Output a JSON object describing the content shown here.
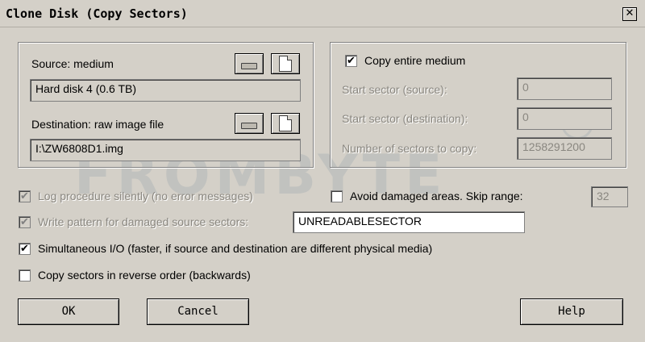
{
  "window": {
    "title": "Clone Disk (Copy Sectors)",
    "close_glyph": "✕"
  },
  "source": {
    "label": "Source: medium",
    "value": "Hard disk 4 (0.6 TB)"
  },
  "destination": {
    "label": "Destination: raw image file",
    "value": "I:\\ZW6808D1.img"
  },
  "copy": {
    "entire_label": "Copy entire medium",
    "entire_checked": true,
    "start_source_label": "Start sector (source):",
    "start_source_value": "0",
    "start_dest_label": "Start sector (destination):",
    "start_dest_value": "0",
    "num_sectors_label": "Number of sectors to copy:",
    "num_sectors_value": "1258291200"
  },
  "options": {
    "log_silently": "Log procedure silently (no error messages)",
    "write_pattern": "Write pattern for damaged source sectors:",
    "pattern_value": "UNREADABLESECTOR",
    "simultaneous_io": "Simultaneous I/O (faster, if source and destination are different physical media)",
    "reverse_order": "Copy sectors in reverse order (backwards)",
    "avoid_damaged": "Avoid damaged areas. Skip range:",
    "skip_range_value": "32"
  },
  "buttons": {
    "ok": "OK",
    "cancel": "Cancel",
    "help": "Help"
  },
  "watermark": {
    "text": "FROMBYTE",
    "registered": "®"
  },
  "icons": {
    "checkmark": "✔"
  }
}
